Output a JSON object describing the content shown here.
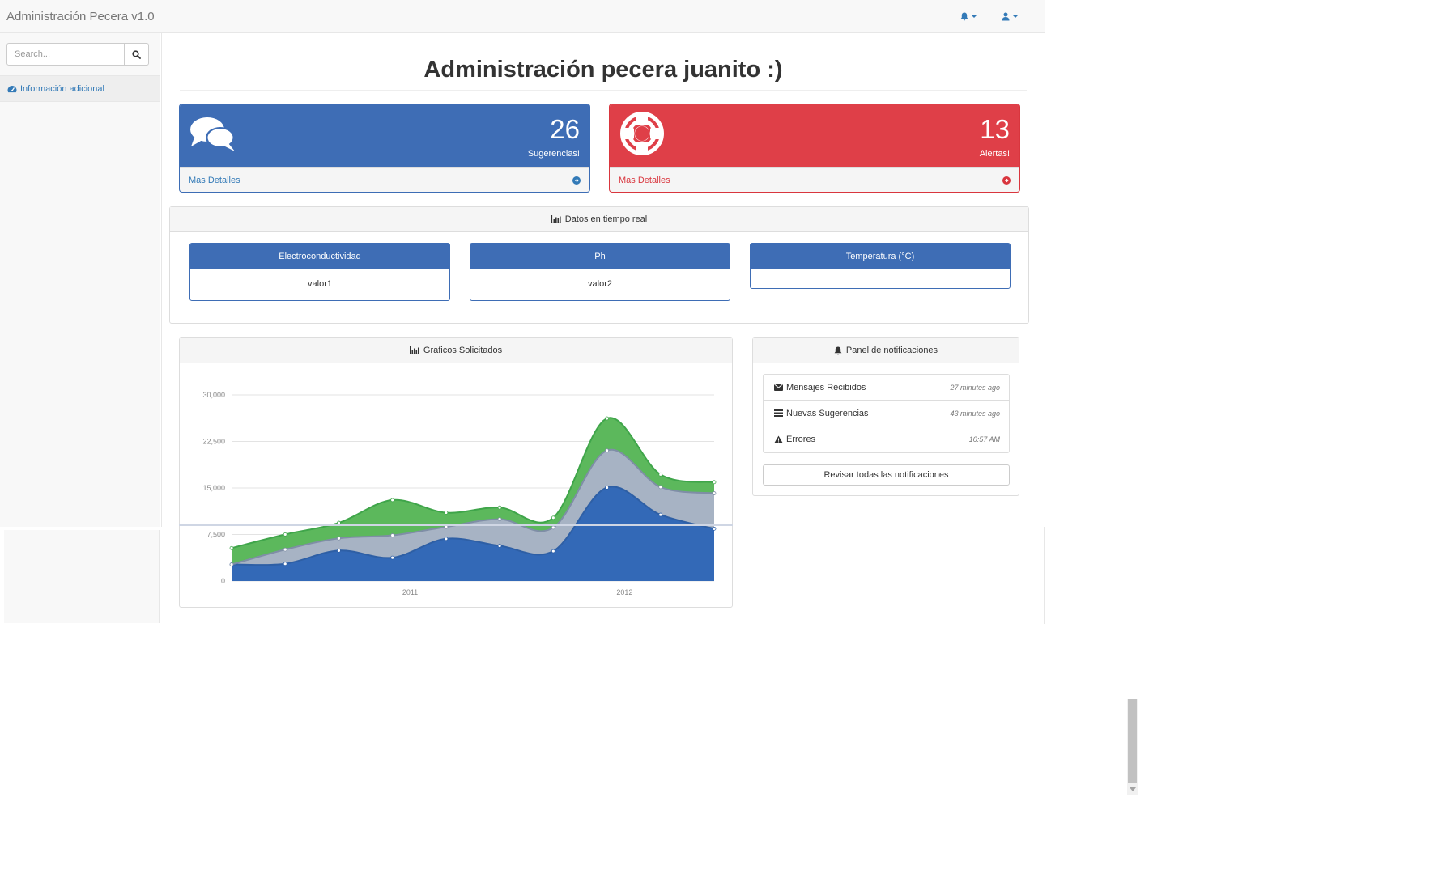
{
  "navbar": {
    "brand": "Administración Pecera v1.0",
    "icons": [
      "bell-icon",
      "user-icon"
    ]
  },
  "sidebar": {
    "search_placeholder": "Search...",
    "items": [
      {
        "label": "Información adicional",
        "icon": "dashboard-icon"
      }
    ]
  },
  "main": {
    "title": "Administración pecera juanito :)",
    "stats": [
      {
        "value": "26",
        "label": "Sugerencias!",
        "link": "Mas Detalles",
        "color": "#3e6db5",
        "icon": "comments-icon"
      },
      {
        "value": "13",
        "label": "Alertas!",
        "link": "Mas Detalles",
        "color": "#df3f48",
        "icon": "life-ring-icon"
      }
    ],
    "realtime": {
      "heading": "Datos en tiempo real",
      "sensors": [
        {
          "label": "Electroconductividad",
          "value": "valor1"
        },
        {
          "label": "Ph",
          "value": "valor2"
        },
        {
          "label": "Temperatura (°C)",
          "value": ""
        }
      ]
    },
    "chart_panel": {
      "heading": "Graficos Solicitados"
    },
    "notifications": {
      "heading": "Panel de notificaciones",
      "items": [
        {
          "label": "Mensajes Recibidos",
          "time": "27 minutes ago",
          "icon": "envelope-icon"
        },
        {
          "label": "Nuevas Sugerencias",
          "time": "43 minutes ago",
          "icon": "tasks-icon"
        },
        {
          "label": "Errores",
          "time": "10:57 AM",
          "icon": "warning-icon"
        }
      ],
      "button": "Revisar todas las notificaciones"
    }
  },
  "chart_data": {
    "type": "area",
    "stacked": true,
    "x": [
      "2010 Q1",
      "2010 Q2",
      "2010 Q3",
      "2010 Q4",
      "2011 Q1",
      "2011 Q2",
      "2011 Q3",
      "2011 Q4",
      "2012 Q1",
      "2012 Q2"
    ],
    "series": [
      {
        "color": "#3369b7",
        "values": [
          2666,
          2778,
          4912,
          3767,
          6810,
          5670,
          4820,
          15073,
          10687,
          8432
        ]
      },
      {
        "color": "#a7b3c4",
        "values": [
          0,
          2294,
          1969,
          3597,
          1914,
          4293,
          3795,
          5967,
          4460,
          5713
        ]
      },
      {
        "color": "#5cb85c",
        "values": [
          2647,
          2441,
          2501,
          5689,
          2293,
          1881,
          1588,
          5175,
          2028,
          1791
        ]
      }
    ],
    "y_ticks": [
      "0",
      "7,500",
      "15,000",
      "22,500",
      "30,000"
    ],
    "x_ticks": [
      "2011",
      "2012"
    ],
    "ylim": [
      0,
      30000
    ],
    "grid": true,
    "legend": "none"
  }
}
